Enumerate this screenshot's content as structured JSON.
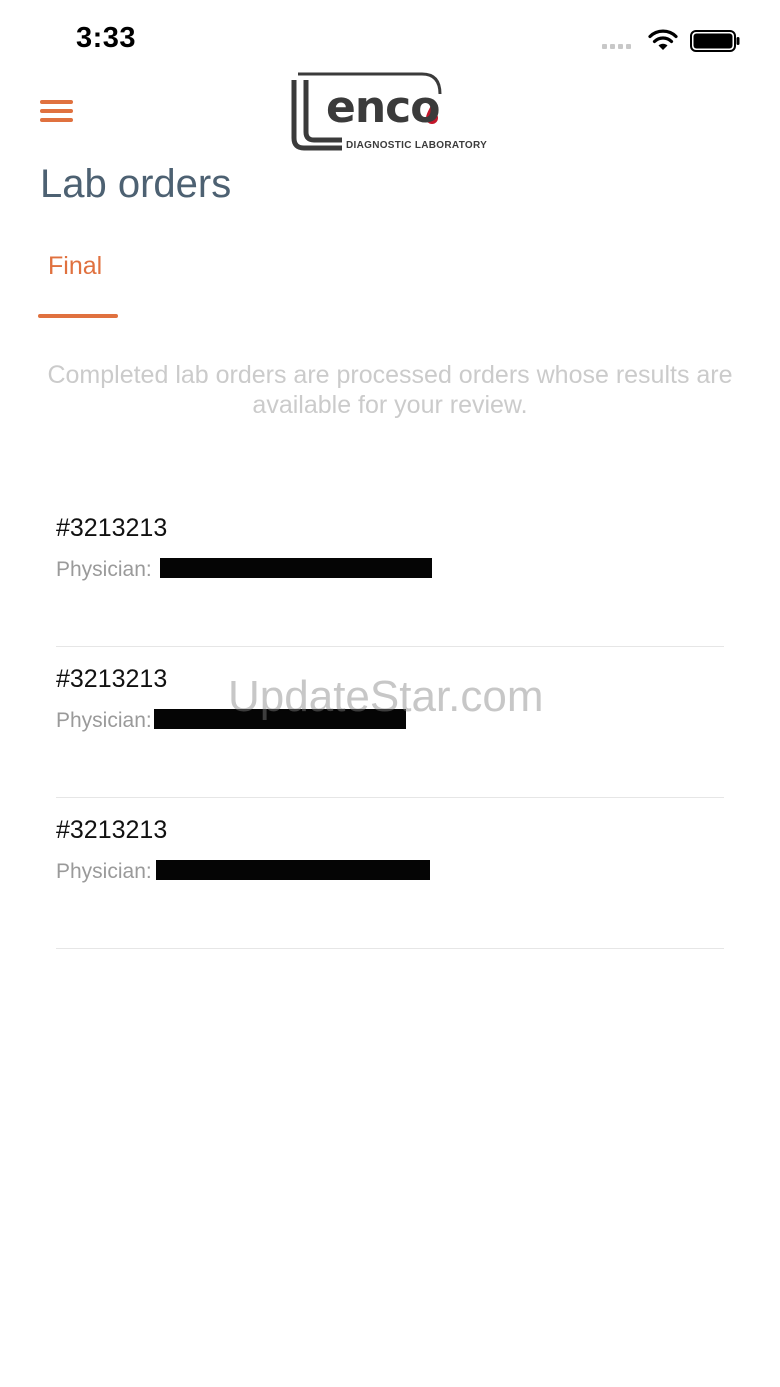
{
  "status_bar": {
    "time": "3:33"
  },
  "header": {
    "logo_word": "enco",
    "logo_subtitle": "DIAGNOSTIC LABORATORY",
    "page_title": "Lab orders"
  },
  "tabs": [
    {
      "label": "Final",
      "active": true
    }
  ],
  "description": "Completed lab orders are processed orders whose results are available for your review.",
  "orders": [
    {
      "number": "#3213213",
      "physician_label": "Physician:"
    },
    {
      "number": "#3213213",
      "physician_label": "Physician:"
    },
    {
      "number": "#3213213",
      "physician_label": "Physician:"
    }
  ],
  "watermark": "UpdateStar.com",
  "colors": {
    "accent": "#e0713f",
    "title": "#4d6172",
    "muted_text": "#9a9a9a",
    "description_text": "#cbcbcb"
  }
}
